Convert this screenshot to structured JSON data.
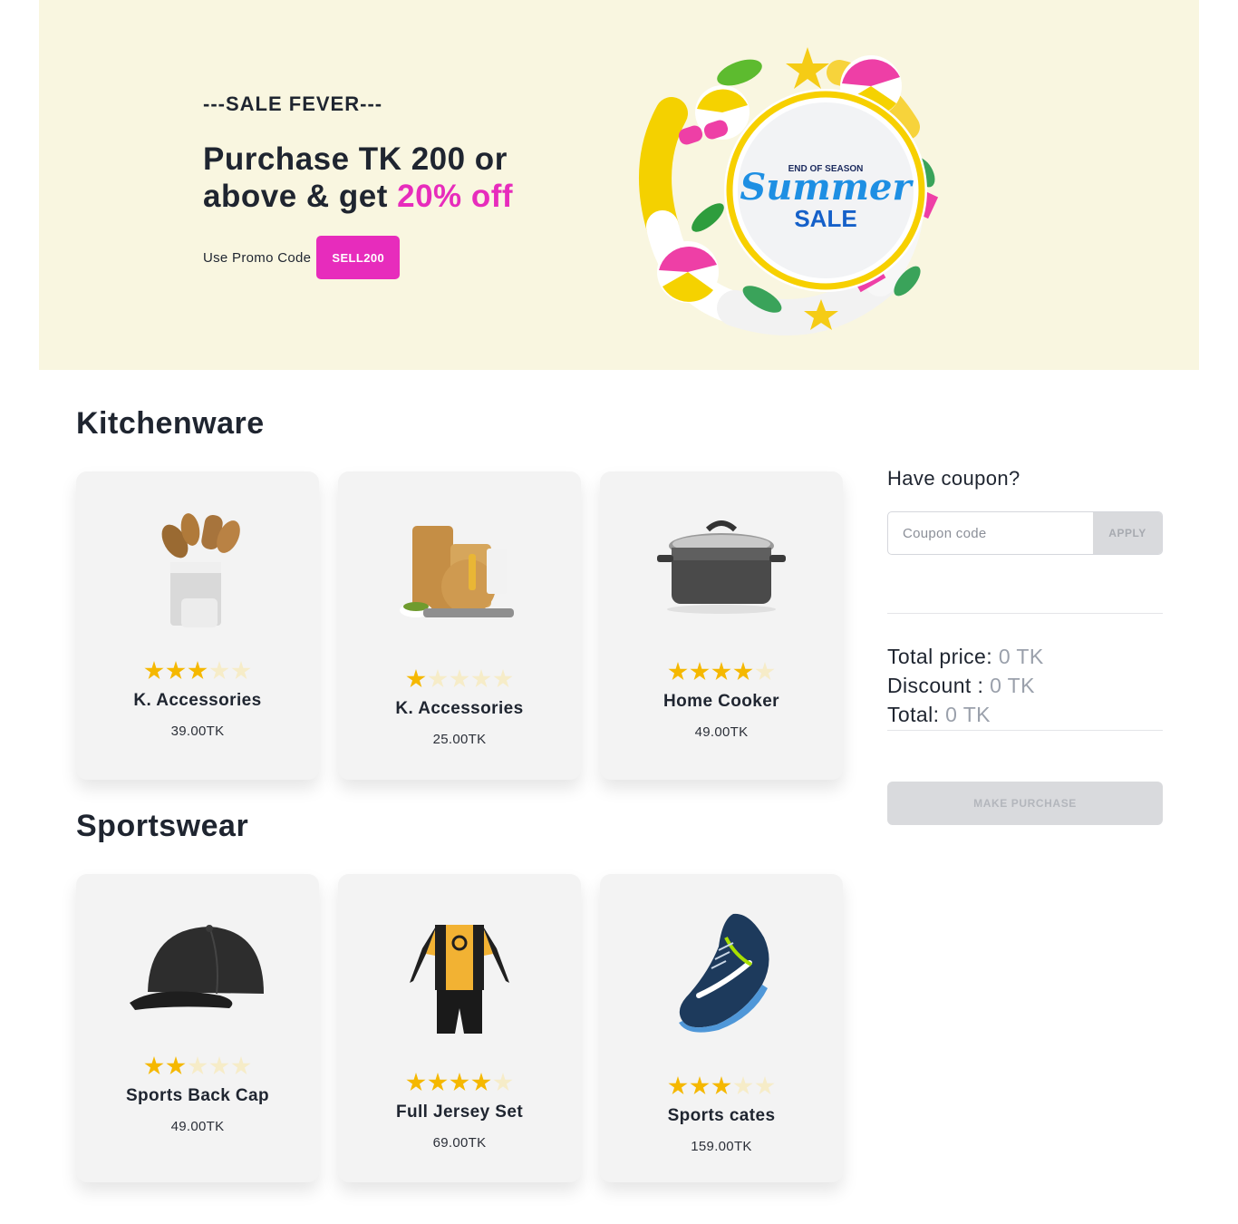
{
  "banner": {
    "eyebrow": "---SALE FEVER---",
    "headline_part1": "Purchase TK 200 or above & get ",
    "headline_accent": "20% off",
    "promo_label": "Use Promo Code",
    "promo_code": "SELL200",
    "art": {
      "top_line": "END OF SEASON",
      "script_word": "Summer",
      "bottom_word": "SALE"
    }
  },
  "sections": [
    {
      "title": "Kitchenware",
      "products": [
        {
          "name": "K. Accessories",
          "price": "39.00TK",
          "rating": 3,
          "icon": "utensil-holder-icon"
        },
        {
          "name": "K. Accessories",
          "price": "25.00TK",
          "rating": 1,
          "icon": "cutting-board-icon"
        },
        {
          "name": "Home Cooker",
          "price": "49.00TK",
          "rating": 4,
          "icon": "cooking-pot-icon"
        }
      ]
    },
    {
      "title": "Sportswear",
      "products": [
        {
          "name": "Sports Back Cap",
          "price": "49.00TK",
          "rating": 2,
          "icon": "baseball-cap-icon"
        },
        {
          "name": "Full Jersey Set",
          "price": "69.00TK",
          "rating": 4,
          "icon": "jersey-suit-icon"
        },
        {
          "name": "Sports cates",
          "price": "159.00TK",
          "rating": 3,
          "icon": "sneaker-icon"
        }
      ]
    }
  ],
  "sidebar": {
    "coupon_title": "Have coupon?",
    "coupon_placeholder": "Coupon code",
    "apply_label": "APPLY",
    "total_price_label": "Total price:",
    "total_price_value": "0 TK",
    "discount_label": "Discount :",
    "discount_value": "0 TK",
    "total_label": "Total:",
    "total_value": "0 TK",
    "purchase_label": "MAKE PURCHASE"
  },
  "colors": {
    "banner_bg": "#f9f6e0",
    "accent_pink": "#e72cbc",
    "star_on": "#f5b800",
    "star_off": "#f6ecc8",
    "card_bg": "#f3f3f3",
    "disabled_button": "#d9dadd"
  }
}
